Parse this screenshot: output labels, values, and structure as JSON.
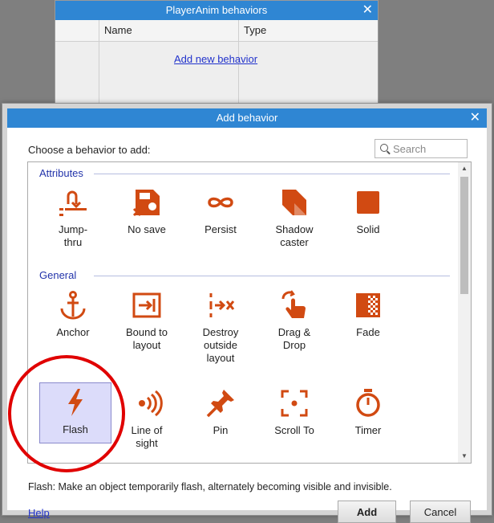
{
  "background_window": {
    "title": "PlayerAnim behaviors",
    "columns": [
      "Name",
      "Type"
    ],
    "add_link": "Add new behavior"
  },
  "dialog": {
    "title": "Add behavior",
    "prompt": "Choose a behavior to add:",
    "search_placeholder": "Search",
    "groups": [
      {
        "title": "Attributes",
        "items": [
          {
            "label": "Jump-\nthru",
            "icon": "jump-thru-icon"
          },
          {
            "label": "No save",
            "icon": "no-save-icon"
          },
          {
            "label": "Persist",
            "icon": "persist-icon"
          },
          {
            "label": "Shadow\ncaster",
            "icon": "shadow-caster-icon"
          },
          {
            "label": "Solid",
            "icon": "solid-icon"
          }
        ]
      },
      {
        "title": "General",
        "items": [
          {
            "label": "Anchor",
            "icon": "anchor-icon"
          },
          {
            "label": "Bound to\nlayout",
            "icon": "bound-to-layout-icon"
          },
          {
            "label": "Destroy\noutside\nlayout",
            "icon": "destroy-outside-layout-icon"
          },
          {
            "label": "Drag &\nDrop",
            "icon": "drag-drop-icon"
          },
          {
            "label": "Fade",
            "icon": "fade-icon"
          },
          {
            "label": "Flash",
            "icon": "flash-icon",
            "selected": true
          },
          {
            "label": "Line of\nsight",
            "icon": "line-of-sight-icon"
          },
          {
            "label": "Pin",
            "icon": "pin-icon"
          },
          {
            "label": "Scroll To",
            "icon": "scroll-to-icon"
          },
          {
            "label": "Timer",
            "icon": "timer-icon"
          }
        ]
      }
    ],
    "description": "Flash: Make an object temporarily flash, alternately becoming visible and invisible.",
    "help_label": "Help",
    "add_label": "Add",
    "cancel_label": "Cancel"
  },
  "colors": {
    "title_bar": "#2f86d3",
    "icon_orange": "#d14a12",
    "selection": "#dcdcfa",
    "annotation": "#e00000"
  }
}
